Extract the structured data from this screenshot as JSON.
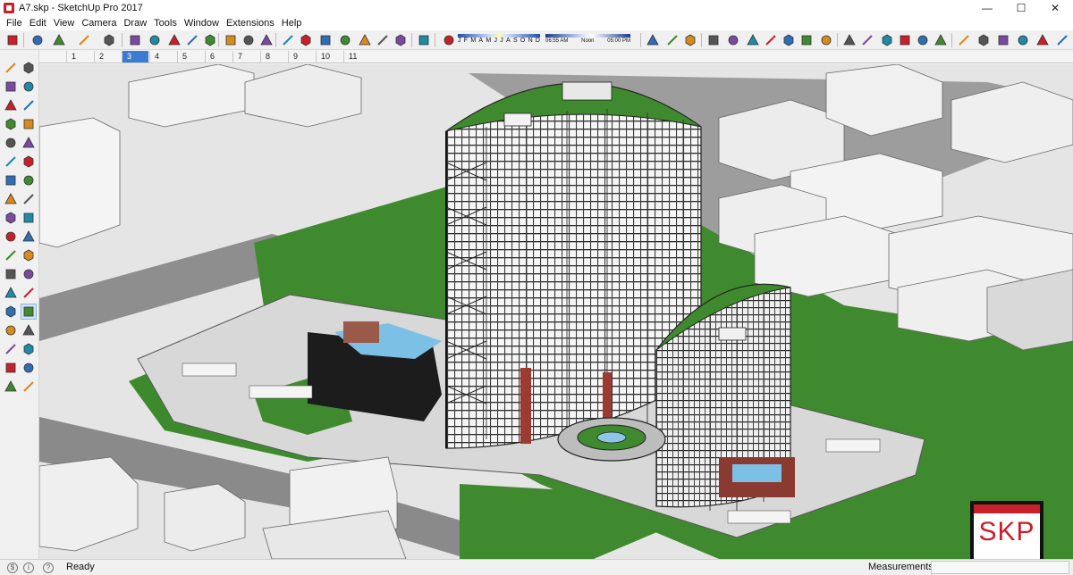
{
  "window": {
    "title": "A7.skp - SketchUp Pro 2017",
    "controls": {
      "minimize": "—",
      "maximize": "☐",
      "close": "✕"
    }
  },
  "menu": [
    "File",
    "Edit",
    "View",
    "Camera",
    "Draw",
    "Tools",
    "Window",
    "Extensions",
    "Help"
  ],
  "shadow_settings": {
    "months": [
      "J",
      "F",
      "M",
      "A",
      "M",
      "J",
      "J",
      "A",
      "S",
      "O",
      "N",
      "D"
    ],
    "time_labels": [
      "06:55 AM",
      "Noon",
      "05:00 PM"
    ]
  },
  "scene_tabs": [
    "1",
    "2",
    "3",
    "4",
    "5",
    "6",
    "7",
    "8",
    "9",
    "10",
    "11"
  ],
  "active_scene_tab": "3",
  "toolbar_icons": [
    "select-icon",
    "eraser-icon",
    "line-icon",
    "shape-icon",
    "paint-bucket-icon",
    "push-pull-icon",
    "follow-me-icon",
    "move-icon",
    "rotate-icon",
    "scale-icon",
    "tape-measure-icon",
    "text-icon",
    "paint-icon",
    "orbit-icon",
    "pan-icon",
    "zoom-icon",
    "zoom-extents-icon",
    "warehouse-icon",
    "extension-icon",
    "layout-icon",
    "ruby-icon",
    "shadows-icon",
    "section-plane-icon",
    "display-section-icon",
    "add-location-icon",
    "xray-icon",
    "back-edges-icon",
    "wireframe-icon",
    "hidden-line-icon",
    "shaded-icon",
    "shaded-textures-icon",
    "monochrome-icon",
    "iso-view-icon",
    "top-view-icon",
    "front-view-icon",
    "right-view-icon",
    "back-view-icon",
    "left-view-icon",
    "outer-shell-icon",
    "intersect-icon",
    "union-icon",
    "subtract-icon",
    "trim-icon",
    "split-icon"
  ],
  "left_tools": [
    "select-icon",
    "component-icon",
    "paint-bucket-icon",
    "eraser-icon",
    "line-icon",
    "freehand-icon",
    "rectangle-icon",
    "rotated-rect-icon",
    "circle-icon",
    "polygon-icon",
    "arc-icon",
    "pie-icon",
    "offset-icon",
    "follow-me-icon",
    "move-icon",
    "push-pull-icon",
    "rotate-icon",
    "scale-icon",
    "offset2-icon",
    "sandbox-icon",
    "tape-measure-icon",
    "dimension-icon",
    "protractor-icon",
    "text-icon",
    "axes-icon",
    "3d-text-icon",
    "orbit-icon",
    "pan-icon",
    "zoom-icon",
    "zoom-window-icon",
    "zoom-extents-icon",
    "previous-icon",
    "walk-icon",
    "look-around-icon",
    "position-camera-icon",
    "section-icon"
  ],
  "status": {
    "text": "Ready",
    "measurements_label": "Measurements",
    "measurements_value": ""
  },
  "badge": {
    "text": "SKP"
  },
  "colors": {
    "accent_red": "#c8202a",
    "grass": "#3f8a2e",
    "tab_active": "#3c7bd1"
  }
}
